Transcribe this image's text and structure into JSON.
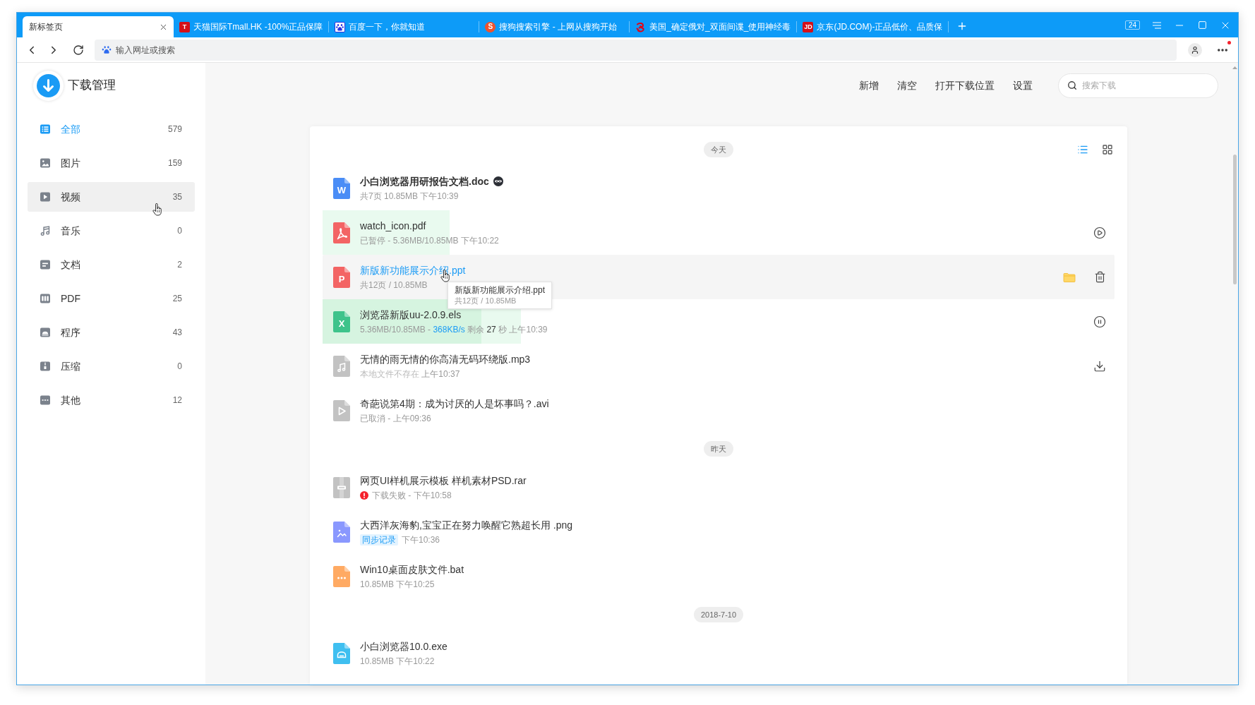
{
  "browser": {
    "tabs": [
      {
        "title": "新标签页",
        "selected": true
      },
      {
        "title": "天猫国际Tmall.HK -100%正品保障",
        "selected": false,
        "favicon": {
          "kind": "tile",
          "text": "T"
        }
      },
      {
        "title": "百度一下，你就知道",
        "selected": false,
        "favicon": {
          "kind": "paw"
        }
      },
      {
        "title": "搜狗搜索引擎 - 上网从搜狗开始",
        "selected": false,
        "favicon": {
          "kind": "ring",
          "text": "S"
        }
      },
      {
        "title": "美国_确定俄对_双面间谍_使用神经毒",
        "selected": false,
        "favicon": {
          "kind": "swirl"
        }
      },
      {
        "title": "京东(JD.COM)-正品低价、品质保",
        "selected": false,
        "favicon": {
          "kind": "tile",
          "text": "JD"
        }
      }
    ],
    "tab_count": "24",
    "address": {
      "placeholder": "输入网址或搜索"
    },
    "more_menu": {
      "badge": true
    }
  },
  "app": {
    "title": "下载管理"
  },
  "sidebar": {
    "items": [
      {
        "kind": "all",
        "label": "全部",
        "count": "579",
        "selected": true,
        "hovered": false
      },
      {
        "kind": "image",
        "label": "图片",
        "count": "159",
        "selected": false,
        "hovered": false
      },
      {
        "kind": "video",
        "label": "视频",
        "count": "35",
        "selected": false,
        "hovered": true
      },
      {
        "kind": "music",
        "label": "音乐",
        "count": "0",
        "selected": false,
        "hovered": false
      },
      {
        "kind": "document",
        "label": "文档",
        "count": "2",
        "selected": false,
        "hovered": false
      },
      {
        "kind": "pdf",
        "label": "PDF",
        "count": "25",
        "selected": false,
        "hovered": false
      },
      {
        "kind": "program",
        "label": "程序",
        "count": "43",
        "selected": false,
        "hovered": false
      },
      {
        "kind": "archive",
        "label": "压缩",
        "count": "0",
        "selected": false,
        "hovered": false
      },
      {
        "kind": "other",
        "label": "其他",
        "count": "12",
        "selected": false,
        "hovered": false
      }
    ]
  },
  "toolbar": {
    "actions": [
      "新增",
      "清空",
      "打开下载位置",
      "设置"
    ],
    "search": {
      "placeholder": "搜索下载"
    }
  },
  "view_modes": [
    {
      "kind": "list",
      "selected": true
    },
    {
      "kind": "grid",
      "selected": false
    }
  ],
  "groups": [
    {
      "label": "今天",
      "rows": [
        {
          "kind": "doc",
          "letter": "W",
          "name": "小白浏览器用研报告文档.doc",
          "unread": true,
          "private": true,
          "hovered": false,
          "available": true,
          "meta": [
            {
              "text": "共7页 10.85MB 下午10:39",
              "kind": "plain"
            }
          ]
        },
        {
          "kind": "pdf",
          "name": "watch_icon.pdf",
          "unread": false,
          "private": false,
          "hovered": false,
          "available": true,
          "level": 0.16,
          "meta": [
            {
              "text": "已暂停 - 5.36MB/10.85MB 下午10:22",
              "kind": "plain"
            }
          ],
          "actions": [
            {
              "kind": "play"
            }
          ]
        },
        {
          "kind": "ppt",
          "letter": "P",
          "name": "新版新功能展示介绍.ppt",
          "unread": false,
          "private": false,
          "hovered": true,
          "available": true,
          "meta": [
            {
              "text": "共12页 / 10.85MB",
              "kind": "plain"
            }
          ],
          "actions": [
            {
              "kind": "folder"
            },
            {
              "kind": "trash"
            }
          ],
          "tooltip": {
            "title": "新版新功能展示介绍.ppt",
            "meta": "共12页 / 10.85MB"
          }
        },
        {
          "kind": "sheet",
          "letter": "X",
          "name": "浏览器新版uu-2.0.9.els",
          "unread": false,
          "private": false,
          "hovered": false,
          "available": true,
          "level": 0.25,
          "meta": [
            {
              "text": "5.36MB/10.85MB - ",
              "kind": "plain"
            },
            {
              "text": "368KB/s",
              "kind": "speed"
            },
            {
              "text": " 剩余 ",
              "kind": "plain"
            },
            {
              "text": "27",
              "kind": "strong"
            },
            {
              "text": " 秒 上午10:39",
              "kind": "plain"
            }
          ],
          "actions": [
            {
              "kind": "pause"
            }
          ]
        },
        {
          "kind": "audio",
          "name": "无情的雨无情的你高清无码环绕版.mp3",
          "unread": false,
          "private": false,
          "hovered": false,
          "available": false,
          "meta": [
            {
              "text": "本地文件不存在",
              "kind": "dim"
            },
            {
              "text": " 上午10:37",
              "kind": "plain"
            }
          ],
          "actions": [
            {
              "kind": "download"
            }
          ]
        },
        {
          "kind": "video",
          "name": "奇葩说第4期：成为讨厌的人是坏事吗？.avi",
          "unread": false,
          "private": false,
          "hovered": false,
          "available": false,
          "meta": [
            {
              "text": "已取消 - 上午09:36",
              "kind": "plain"
            }
          ]
        }
      ]
    },
    {
      "label": "昨天",
      "rows": [
        {
          "kind": "archive",
          "name": "网页UI样机展示模板 样机素材PSD.rar",
          "unread": false,
          "private": false,
          "hovered": false,
          "available": false,
          "meta": [
            {
              "kind": "error"
            },
            {
              "text": "下载失败 - 下午10:58",
              "kind": "plain"
            }
          ]
        },
        {
          "kind": "image",
          "name": "大西洋灰海豹,宝宝正在努力唤醒它熟超长用 .png",
          "unread": false,
          "private": false,
          "hovered": false,
          "available": true,
          "meta": [
            {
              "text": "同步记录",
              "kind": "tag"
            },
            {
              "text": "下午10:36",
              "kind": "plain"
            }
          ]
        },
        {
          "kind": "script",
          "name": "Win10桌面皮肤文件.bat",
          "unread": false,
          "private": false,
          "hovered": false,
          "available": true,
          "meta": [
            {
              "text": "10.85MB 下午10:25",
              "kind": "plain"
            }
          ]
        }
      ]
    },
    {
      "label": "2018-7-10",
      "rows": [
        {
          "kind": "program",
          "name": "小白浏览器10.0.exe",
          "unread": false,
          "private": false,
          "hovered": false,
          "available": true,
          "meta": [
            {
              "text": "10.85MB 下午10:22",
              "kind": "plain"
            }
          ]
        }
      ]
    }
  ]
}
